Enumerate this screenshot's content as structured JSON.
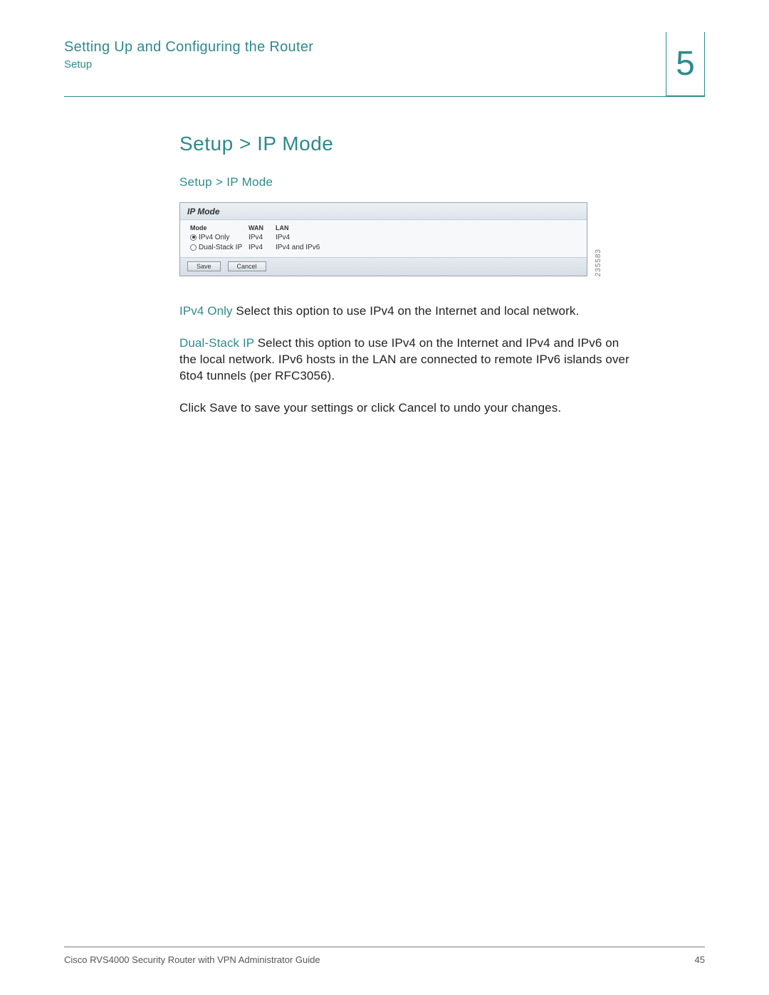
{
  "header": {
    "title": "Setting Up and Configuring the Router",
    "subtitle": "Setup",
    "chapter": "5"
  },
  "main": {
    "heading": "Setup > IP Mode",
    "subheading": "Setup > IP Mode"
  },
  "screenshot": {
    "panel_title": "IP Mode",
    "columns": {
      "mode": "Mode",
      "wan": "WAN",
      "lan": "LAN"
    },
    "rows": [
      {
        "selected": true,
        "mode": "IPv4 Only",
        "wan": "IPv4",
        "lan": "IPv4"
      },
      {
        "selected": false,
        "mode": "Dual-Stack IP",
        "wan": "IPv4",
        "lan": "IPv4 and IPv6"
      }
    ],
    "buttons": {
      "save": "Save",
      "cancel": "Cancel"
    },
    "image_id": "235583"
  },
  "paragraphs": {
    "p1_term": "IPv4 Only",
    "p1_rest": " Select this option to use IPv4 on the Internet and local network.",
    "p2_term": "Dual-Stack IP",
    "p2_rest": " Select this option to use IPv4 on the Internet and IPv4 and IPv6 on the local network. IPv6 hosts in the LAN are connected to remote IPv6 islands over 6to4 tunnels (per RFC3056).",
    "p3": "Click Save to save your settings or click Cancel to undo your changes."
  },
  "footer": {
    "guide": "Cisco RVS4000 Security Router with VPN Administrator Guide",
    "page": "45"
  }
}
